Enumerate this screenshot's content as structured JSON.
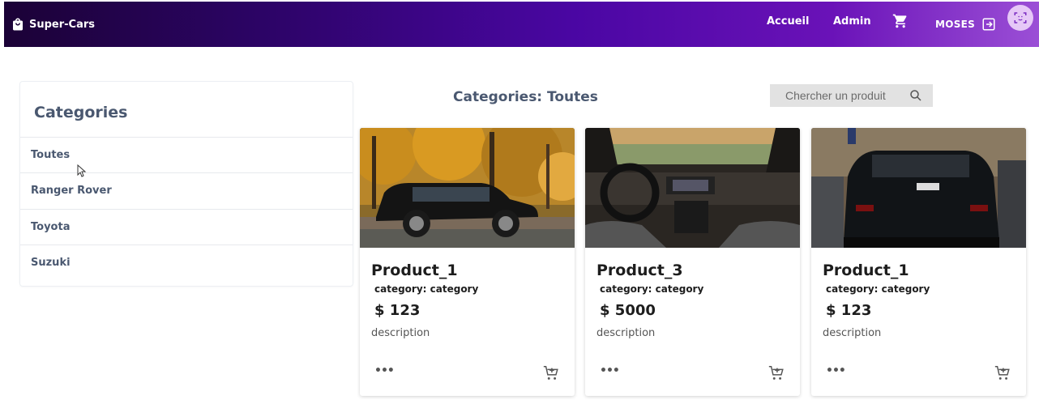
{
  "navbar": {
    "brand": "Super-Cars",
    "links": [
      "Accueil",
      "Admin"
    ],
    "cart_icon": "cart-icon",
    "user_name": "MOSES",
    "logout_icon": "logout-icon",
    "avatar_icon": "face-scan-icon",
    "colors": {
      "gradient_start": "#1b0236",
      "gradient_end": "#9b4fd6"
    }
  },
  "sidebar": {
    "title": "Categories",
    "items": [
      "Toutes",
      "Ranger Rover",
      "Toyota",
      "Suzuki"
    ]
  },
  "main": {
    "title": "Categories: Toutes",
    "search": {
      "placeholder": "Chercher un produit",
      "icon": "search-icon"
    }
  },
  "products": [
    {
      "name": "Product_1",
      "category": "category: category",
      "price": "$ 123",
      "description": "description",
      "more": "•••",
      "image": "black-suv-autumn"
    },
    {
      "name": "Product_3",
      "category": "category: category",
      "price": "$ 5000",
      "description": "description",
      "more": "•••",
      "image": "car-interior-dashboard"
    },
    {
      "name": "Product_1",
      "category": "category: category",
      "price": "$ 123",
      "description": "description",
      "more": "•••",
      "image": "black-range-rover-rear"
    }
  ]
}
